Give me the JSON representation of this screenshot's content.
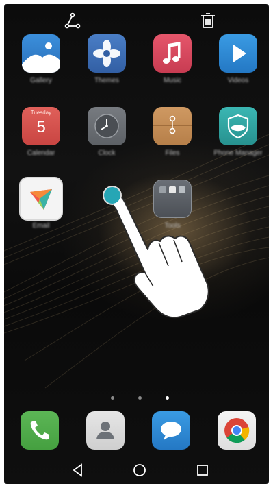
{
  "top_actions": {
    "left_icon": "share-icon",
    "right_icon": "trash-icon"
  },
  "home_apps": [
    {
      "icon": "gallery-icon",
      "label": "Gallery",
      "color": "#2f7fcf"
    },
    {
      "icon": "themes-icon",
      "label": "Themes",
      "color": "#3d6fb7"
    },
    {
      "icon": "music-icon",
      "label": "Music",
      "color": "#d9495d"
    },
    {
      "icon": "videos-icon",
      "label": "Videos",
      "color": "#2c8bd6"
    },
    {
      "icon": "calendar-icon",
      "label": "Calendar",
      "color": "#d9544f",
      "day": "Tuesday",
      "date": "5"
    },
    {
      "icon": "clock-icon",
      "label": "Clock",
      "color": "#6b6f73"
    },
    {
      "icon": "files-icon",
      "label": "Files",
      "color": "#c58d56"
    },
    {
      "icon": "phone-manager-icon",
      "label": "Phone Manager",
      "color": "#2ea4a2"
    },
    {
      "icon": "email-icon",
      "label": "Email",
      "color": "#f4f4f4"
    },
    {
      "icon": "folder-icon",
      "label": "Tools",
      "color": "#5a5f66"
    }
  ],
  "dock_apps": [
    {
      "icon": "phone-icon",
      "color": "#4fad4a"
    },
    {
      "icon": "contacts-icon",
      "color": "#d9d9d9"
    },
    {
      "icon": "messaging-icon",
      "color": "#2c8bd6"
    },
    {
      "icon": "chrome-icon",
      "color": "#eaeaea"
    }
  ],
  "page_indicator": {
    "count": 3,
    "active_index": 2
  },
  "nav_bar": [
    "back-icon",
    "home-icon",
    "recents-icon"
  ],
  "gesture": {
    "type": "touch-and-drag",
    "touch_color": "#26a6b5"
  }
}
